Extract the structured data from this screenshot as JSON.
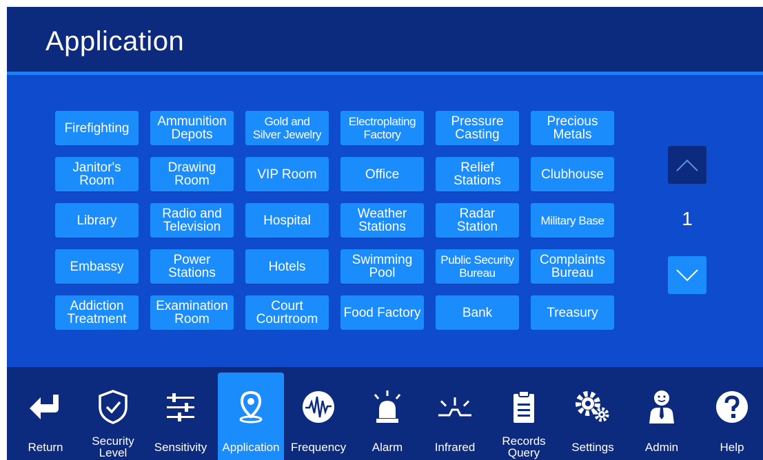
{
  "header": {
    "title": "Application"
  },
  "applications": [
    {
      "label": "Firefighting"
    },
    {
      "label": "Ammunition\nDepots"
    },
    {
      "label": "Gold and\nSilver Jewelry"
    },
    {
      "label": "Electroplating\nFactory"
    },
    {
      "label": "Pressure\nCasting"
    },
    {
      "label": "Precious\nMetals"
    },
    {
      "label": "Janitor's\nRoom"
    },
    {
      "label": "Drawing\nRoom"
    },
    {
      "label": "VIP Room"
    },
    {
      "label": "Office"
    },
    {
      "label": "Relief\nStations"
    },
    {
      "label": "Clubhouse"
    },
    {
      "label": "Library"
    },
    {
      "label": "Radio and\nTelevision"
    },
    {
      "label": "Hospital"
    },
    {
      "label": "Weather\nStations"
    },
    {
      "label": "Radar\nStation"
    },
    {
      "label": "Military Base"
    },
    {
      "label": "Embassy"
    },
    {
      "label": "Power\nStations"
    },
    {
      "label": "Hotels"
    },
    {
      "label": "Swimming\nPool"
    },
    {
      "label": "Public Security\nBureau"
    },
    {
      "label": "Complaints\nBureau"
    },
    {
      "label": "Addiction\nTreatment"
    },
    {
      "label": "Examination\nRoom"
    },
    {
      "label": "Court\nCourtroom"
    },
    {
      "label": "Food Factory"
    },
    {
      "label": "Bank"
    },
    {
      "label": "Treasury"
    }
  ],
  "pager": {
    "page": "1",
    "up_icon": "chevron-up-icon",
    "down_icon": "chevron-down-icon"
  },
  "toolbar": {
    "active": "Application",
    "items": [
      {
        "label": "Return",
        "icon": "return-arrow-icon"
      },
      {
        "label": "Security\nLevel",
        "icon": "shield-check-icon"
      },
      {
        "label": "Sensitivity",
        "icon": "sliders-icon"
      },
      {
        "label": "Application",
        "icon": "location-pin-icon"
      },
      {
        "label": "Frequency",
        "icon": "waveform-icon"
      },
      {
        "label": "Alarm",
        "icon": "alarm-light-icon"
      },
      {
        "label": "Infrared",
        "icon": "infrared-icon"
      },
      {
        "label": "Records\nQuery",
        "icon": "clipboard-icon"
      },
      {
        "label": "Settings",
        "icon": "gears-icon"
      },
      {
        "label": "Admin",
        "icon": "admin-user-icon"
      },
      {
        "label": "Help",
        "icon": "help-icon"
      }
    ]
  },
  "colors": {
    "background": "#0f4bcd",
    "header": "#0c2a7e",
    "accent_line": "#1f7ef5",
    "button": "#1b8cfb",
    "text": "#ffffff"
  }
}
